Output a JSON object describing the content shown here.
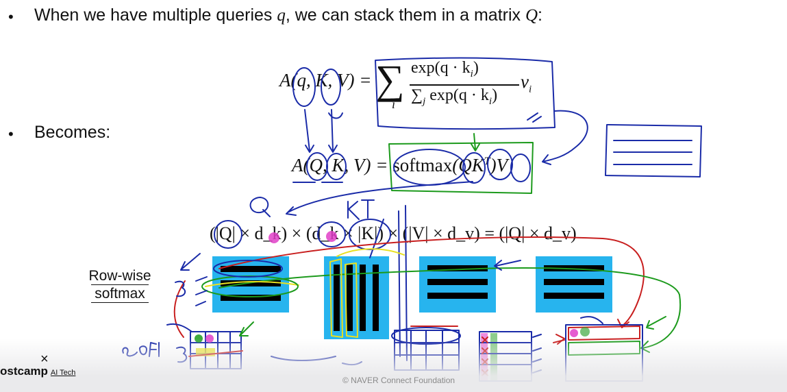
{
  "slide": {
    "bullet_char": "•",
    "line1": {
      "text": "When we have multiple queries ",
      "q": "q",
      "mid": ", we can stack them in a matrix ",
      "Q": "Q",
      "end": ":"
    },
    "line2": "Becomes:",
    "eq1": {
      "lhs": "A(q, K, V) = ",
      "sum": "∑",
      "sub": "i",
      "num": "exp(q · k",
      "num_i": "i",
      ")": ")",
      "den": "∑",
      "den_j": "j",
      "den_rest": " exp(q · k",
      "den_i": "i",
      "v": " v",
      "v_i": "i"
    },
    "eq2": {
      "lhs": "A(Q, K, V) = ",
      "softmax": "softmax",
      "arg": "(QK",
      "sup": "T",
      "rest": ")V"
    },
    "eq3": "(|Q| × d_k) × (d_k × |K|) × (|V| × d_v) = (|Q| × d_v)",
    "row_wise_label": [
      "Row-wise",
      "softmax"
    ]
  },
  "footer": {
    "logo": "ostcamp",
    "logo_suffix": "AI Tech",
    "close_glyph": "×",
    "copyright": "© NAVER Connect Foundation"
  },
  "colors": {
    "block": "#27b4ee",
    "ink_blue": "#1a2ba8",
    "ink_green": "#1c9a1c",
    "ink_red": "#c81e1e",
    "ink_pink": "#e040c8",
    "ink_yellow": "#e8e020"
  }
}
